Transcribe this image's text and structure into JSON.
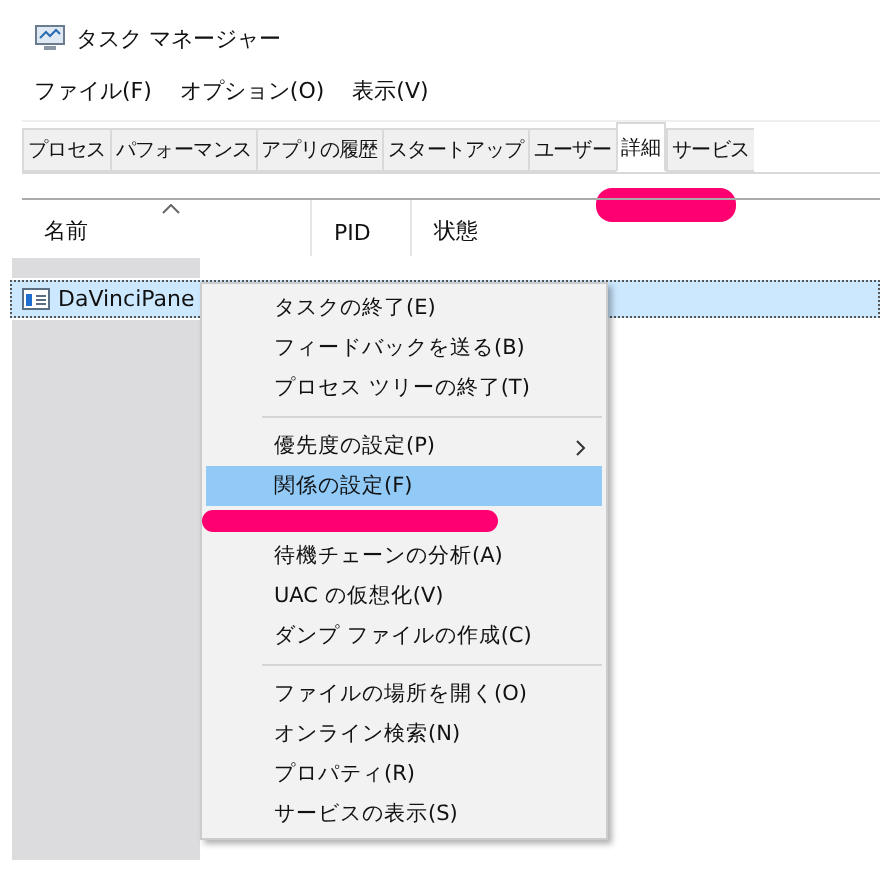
{
  "window": {
    "title": "タスク マネージャー"
  },
  "menu_bar": [
    "ファイル(F)",
    "オプション(O)",
    "表示(V)"
  ],
  "tabs": [
    {
      "label": "プロセス",
      "selected": false
    },
    {
      "label": "パフォーマンス",
      "selected": false
    },
    {
      "label": "アプリの履歴",
      "selected": false
    },
    {
      "label": "スタートアップ",
      "selected": false
    },
    {
      "label": "ユーザー",
      "selected": false
    },
    {
      "label": "詳細",
      "selected": true,
      "marked": true
    },
    {
      "label": "サービス",
      "selected": false
    }
  ],
  "table": {
    "columns": [
      {
        "label": "名前",
        "sorted": true
      },
      {
        "label": "PID",
        "sorted": false
      },
      {
        "label": "状態",
        "sorted": false
      }
    ],
    "rows": [
      {
        "name": "DaVinciPane",
        "selected": true
      }
    ]
  },
  "context_menu": [
    {
      "kind": "item",
      "label": "タスクの終了(E)",
      "selected": false
    },
    {
      "kind": "item",
      "label": "フィードバックを送る(B)",
      "selected": false
    },
    {
      "kind": "item",
      "label": "プロセス ツリーの終了(T)",
      "selected": false
    },
    {
      "kind": "separator"
    },
    {
      "kind": "submenu",
      "label": "優先度の設定(P)",
      "selected": false
    },
    {
      "kind": "item",
      "label": "関係の設定(F)",
      "selected": true,
      "marked": true
    },
    {
      "kind": "item",
      "label": "待機チェーンの分析(A)",
      "selected": false
    },
    {
      "kind": "item",
      "label": "UAC の仮想化(V)",
      "selected": false
    },
    {
      "kind": "item",
      "label": "ダンプ ファイルの作成(C)",
      "selected": false
    },
    {
      "kind": "separator"
    },
    {
      "kind": "item",
      "label": "ファイルの場所を開く(O)",
      "selected": false
    },
    {
      "kind": "item",
      "label": "オンライン検索(N)",
      "selected": false
    },
    {
      "kind": "item",
      "label": "プロパティ(R)",
      "selected": false
    },
    {
      "kind": "item",
      "label": "サービスの表示(S)",
      "selected": false
    }
  ]
}
